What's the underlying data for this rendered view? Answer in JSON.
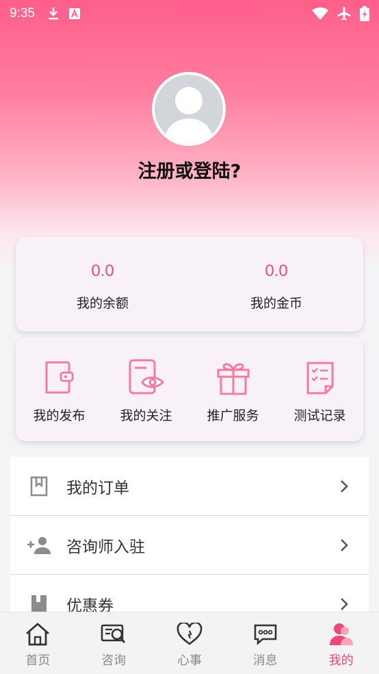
{
  "status_bar": {
    "time": "9:35"
  },
  "profile": {
    "login_text": "注册或登陆?"
  },
  "wallet": [
    {
      "value": "0.0",
      "label": "我的余额"
    },
    {
      "value": "0.0",
      "label": "我的金币"
    }
  ],
  "quick_actions": [
    {
      "label": "我的发布",
      "icon": "wallet-icon"
    },
    {
      "label": "我的关注",
      "icon": "eye-document-icon"
    },
    {
      "label": "推广服务",
      "icon": "gift-icon"
    },
    {
      "label": "测试记录",
      "icon": "checklist-icon"
    }
  ],
  "menu": [
    {
      "label": "我的订单",
      "icon": "bookmark-icon"
    },
    {
      "label": "咨询师入驻",
      "icon": "add-person-icon"
    },
    {
      "label": "优惠券",
      "icon": "book-icon"
    }
  ],
  "tabs": [
    {
      "label": "首页",
      "icon": "home-icon",
      "active": false
    },
    {
      "label": "咨询",
      "icon": "consult-icon",
      "active": false
    },
    {
      "label": "心事",
      "icon": "heart-icon",
      "active": false
    },
    {
      "label": "消息",
      "icon": "message-icon",
      "active": false
    },
    {
      "label": "我的",
      "icon": "profile-icon",
      "active": true
    }
  ],
  "colors": {
    "accent": "#f0477a",
    "hero_top": "#ff5f8a",
    "icon_pink": "#f47aa0",
    "inactive": "#8a8a8a"
  }
}
